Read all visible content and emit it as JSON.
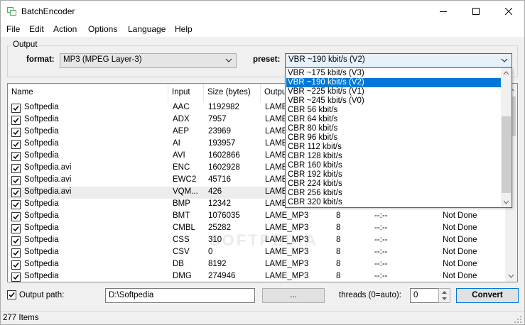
{
  "window": {
    "title": "BatchEncoder"
  },
  "menu": [
    "File",
    "Edit",
    "Action",
    "Options",
    "Language",
    "Help"
  ],
  "output": {
    "group_label": "Output",
    "format_label": "format:",
    "format_value": "MP3 (MPEG Layer-3)",
    "preset_label": "preset:",
    "preset_value": "VBR ~190 kbit/s (V2)"
  },
  "preset_options": [
    "VBR ~175 kbit/s (V3)",
    "VBR ~190 kbit/s (V2)",
    "VBR ~225 kbit/s (V1)",
    "VBR ~245 kbit/s (V0)",
    "CBR 56 kbit/s",
    "CBR 64 kbit/s",
    "CBR 80 kbit/s",
    "CBR 96 kbit/s",
    "CBR 112 kbit/s",
    "CBR 128 kbit/s",
    "CBR 160 kbit/s",
    "CBR 192 kbit/s",
    "CBR 224 kbit/s",
    "CBR 256 kbit/s",
    "CBR 320 kbit/s"
  ],
  "columns": [
    "Name",
    "Input",
    "Size (bytes)",
    "Output"
  ],
  "rows": [
    {
      "name": "Softpedia",
      "input": "AAC",
      "size": "1192982",
      "output": "LAME_",
      "threads": "",
      "time": "",
      "status": ""
    },
    {
      "name": "Softpedia",
      "input": "ADX",
      "size": "7957",
      "output": "LAME_",
      "threads": "",
      "time": "",
      "status": ""
    },
    {
      "name": "Softpedia",
      "input": "AEP",
      "size": "23969",
      "output": "LAME_",
      "threads": "",
      "time": "",
      "status": ""
    },
    {
      "name": "Softpedia",
      "input": "AI",
      "size": "193957",
      "output": "LAME_",
      "threads": "",
      "time": "",
      "status": ""
    },
    {
      "name": "Softpedia",
      "input": "AVI",
      "size": "1602866",
      "output": "LAME_",
      "threads": "",
      "time": "",
      "status": ""
    },
    {
      "name": "Softpedia.avi",
      "input": "ENC",
      "size": "1602928",
      "output": "LAME_",
      "threads": "",
      "time": "",
      "status": ""
    },
    {
      "name": "Softpedia.avi",
      "input": "EWC2",
      "size": "45716",
      "output": "LAME_",
      "threads": "",
      "time": "",
      "status": ""
    },
    {
      "name": "Softpedia.avi",
      "input": "VQM...",
      "size": "426",
      "output": "LAME_",
      "threads": "",
      "time": "",
      "status": ""
    },
    {
      "name": "Softpedia",
      "input": "BMP",
      "size": "12342",
      "output": "LAME_",
      "threads": "",
      "time": "",
      "status": ""
    },
    {
      "name": "Softpedia",
      "input": "BMT",
      "size": "1076035",
      "output": "LAME_MP3",
      "threads": "8",
      "time": "--:--",
      "status": "Not Done"
    },
    {
      "name": "Softpedia",
      "input": "CMBL",
      "size": "25282",
      "output": "LAME_MP3",
      "threads": "8",
      "time": "--:--",
      "status": "Not Done"
    },
    {
      "name": "Softpedia",
      "input": "CSS",
      "size": "310",
      "output": "LAME_MP3",
      "threads": "8",
      "time": "--:--",
      "status": "Not Done"
    },
    {
      "name": "Softpedia",
      "input": "CSV",
      "size": "0",
      "output": "LAME_MP3",
      "threads": "8",
      "time": "--:--",
      "status": "Not Done"
    },
    {
      "name": "Softpedia",
      "input": "DB",
      "size": "8192",
      "output": "LAME_MP3",
      "threads": "8",
      "time": "--:--",
      "status": "Not Done"
    },
    {
      "name": "Softpedia",
      "input": "DMG",
      "size": "274946",
      "output": "LAME_MP3",
      "threads": "8",
      "time": "--:--",
      "status": "Not Done"
    }
  ],
  "watermark": "SOFTPEDIA",
  "bottom": {
    "output_path_label": "Output path:",
    "output_path_value": "D:\\Softpedia",
    "browse_label": "...",
    "threads_label": "threads (0=auto):",
    "threads_value": "0",
    "convert_label": "Convert"
  },
  "status": {
    "items": "277 Items"
  },
  "colors": {
    "selection": "#0078d7",
    "app_icon": "#4caf50"
  }
}
